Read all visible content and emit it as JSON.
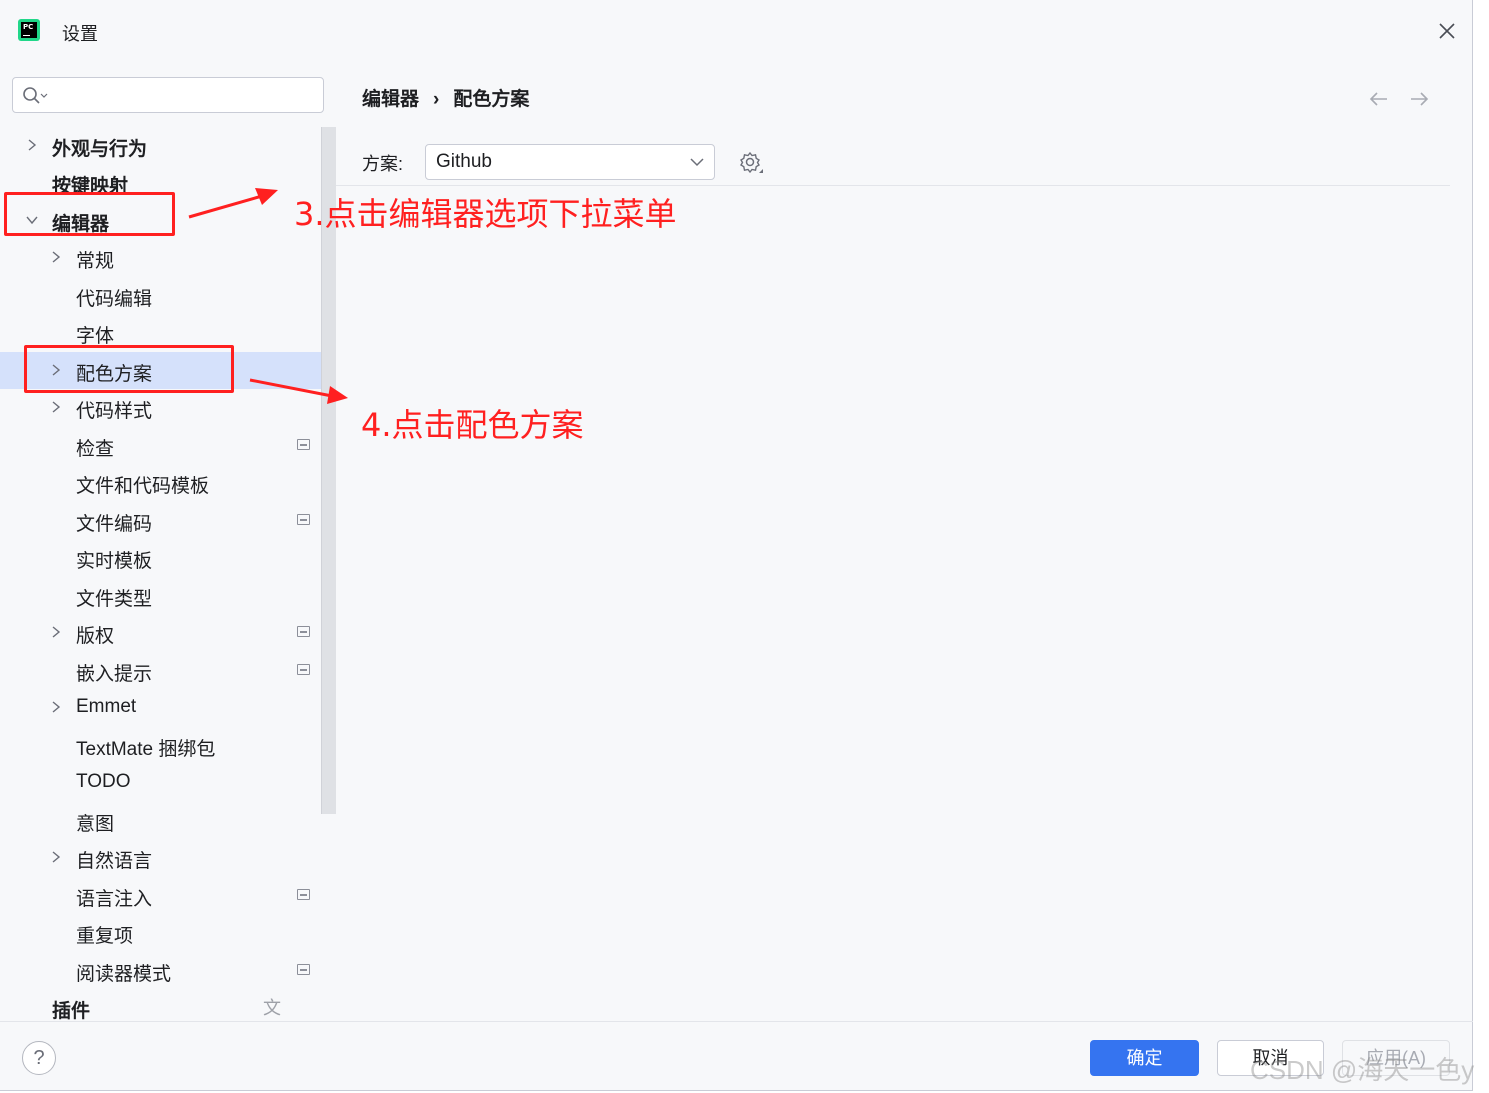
{
  "window": {
    "title": "设置",
    "close_icon": "close-icon",
    "app_icon": "pycharm-icon",
    "app_icon_text": "PC"
  },
  "search": {
    "placeholder": "",
    "value": ""
  },
  "tree": {
    "appearance": "外观与行为",
    "keymap": "按键映射",
    "editor": "编辑器",
    "general": "常规",
    "code_editing": "代码编辑",
    "font": "字体",
    "color_scheme": "配色方案",
    "code_style": "代码样式",
    "inspections": "检查",
    "file_templates": "文件和代码模板",
    "file_encodings": "文件编码",
    "live_templates": "实时模板",
    "file_types": "文件类型",
    "copyright": "版权",
    "inlay_hints": "嵌入提示",
    "emmet": "Emmet",
    "textmate": "TextMate 捆绑包",
    "todo": "TODO",
    "intentions": "意图",
    "natural_languages": "自然语言",
    "language_injections": "语言注入",
    "duplicates": "重复项",
    "reader_mode": "阅读器模式",
    "plugins": "插件",
    "plugins_icon": "文"
  },
  "content": {
    "breadcrumb_parent": "编辑器",
    "breadcrumb_sep": "›",
    "breadcrumb_current": "配色方案",
    "scheme_label": "方案:",
    "scheme_value": "Github"
  },
  "footer": {
    "help": "?",
    "ok": "确定",
    "cancel": "取消",
    "apply": "应用(A)"
  },
  "annotations": {
    "step3": "3.点击编辑器选项下拉菜单",
    "step4": "4.点击配色方案",
    "color": "#ff2020"
  },
  "watermark": "CSDN @海天一色y",
  "colors": {
    "accent": "#3574f0",
    "selection": "#d5e1fb"
  }
}
